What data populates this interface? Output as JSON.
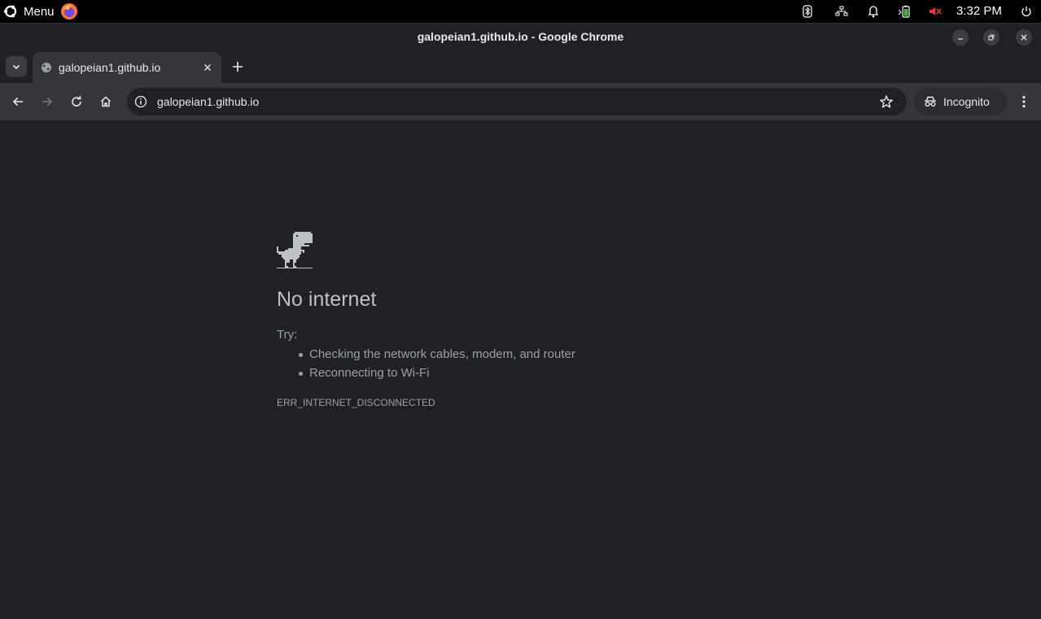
{
  "system_panel": {
    "menu_label": "Menu",
    "clock": "3:32 PM",
    "tray_icons": [
      "bluetooth-icon",
      "network-icon",
      "notifications-icon",
      "battery-icon",
      "volume-muted-icon",
      "power-icon"
    ],
    "volume_muted_color": "#e53935",
    "battery_color": "#4caf50"
  },
  "window": {
    "title": "galopeian1.github.io - Google Chrome"
  },
  "tabs": [
    {
      "title": "galopeian1.github.io",
      "active": true
    }
  ],
  "toolbar": {
    "url": "galopeian1.github.io",
    "incognito_label": "Incognito"
  },
  "page": {
    "heading": "No internet",
    "try_label": "Try:",
    "suggestions": [
      "Checking the network cables, modem, and router",
      "Reconnecting to Wi-Fi"
    ],
    "error_code": "ERR_INTERNET_DISCONNECTED"
  },
  "colors": {
    "background": "#202124",
    "toolbar": "#35363a",
    "heading_text": "#bdc1c6",
    "body_text": "#9aa0a6"
  }
}
